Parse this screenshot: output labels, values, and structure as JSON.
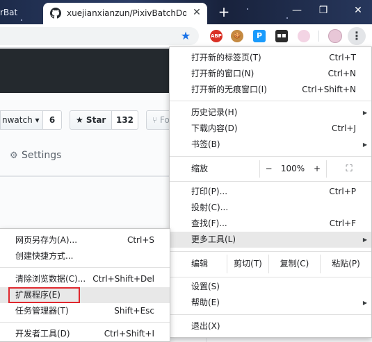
{
  "tabs": {
    "left_partial_title": "rBat",
    "active_title": "xuejianxianzun/PixivBatchDow",
    "close_glyph": "✕",
    "new_tab_glyph": "+"
  },
  "window_controls": {
    "minimize": "—",
    "restore": "❐",
    "close": "✕"
  },
  "toolbar": {
    "bookmark_icon": "star-icon",
    "extensions": [
      {
        "name": "adblock-plus",
        "label": "ABP"
      },
      {
        "name": "cookie",
        "label": "🍪"
      },
      {
        "name": "pixiv-p",
        "label": "P"
      },
      {
        "name": "dark-ext",
        "label": "▪▪"
      },
      {
        "name": "anime-ext",
        "label": ""
      }
    ],
    "menu_glyph": "⋮",
    "accent": "#1a73e8"
  },
  "github": {
    "watch_label": "nwatch ▾",
    "watch_count": "6",
    "star_label": "★ Star",
    "star_count": "132",
    "fork_partial": "⑂ Fo",
    "settings_tab": "Settings"
  },
  "menu": {
    "items": [
      {
        "label": "打开新的标签页(T)",
        "shortcut": "Ctrl+T"
      },
      {
        "label": "打开新的窗口(N)",
        "shortcut": "Ctrl+N"
      },
      {
        "label": "打开新的无痕窗口(I)",
        "shortcut": "Ctrl+Shift+N"
      },
      {
        "label": "历史记录(H)",
        "shortcut": ""
      },
      {
        "label": "下载内容(D)",
        "shortcut": "Ctrl+J"
      },
      {
        "label": "书签(B)",
        "shortcut": ""
      },
      {
        "label": "打印(P)...",
        "shortcut": "Ctrl+P"
      },
      {
        "label": "投射(C)...",
        "shortcut": ""
      },
      {
        "label": "查找(F)...",
        "shortcut": "Ctrl+F"
      },
      {
        "label": "更多工具(L)",
        "shortcut": ""
      },
      {
        "label": "设置(S)",
        "shortcut": ""
      },
      {
        "label": "帮助(E)",
        "shortcut": ""
      },
      {
        "label": "退出(X)",
        "shortcut": ""
      }
    ],
    "zoom": {
      "label": "缩放",
      "minus": "−",
      "value": "100%",
      "plus": "+",
      "fullscreen": "⛶"
    },
    "edit": {
      "label": "编辑",
      "cut": "剪切(T)",
      "copy": "复制(C)",
      "paste": "粘贴(P)"
    },
    "arrow": "▶"
  },
  "submenu": {
    "items": [
      {
        "label": "网页另存为(A)...",
        "shortcut": "Ctrl+S"
      },
      {
        "label": "创建快捷方式...",
        "shortcut": ""
      },
      {
        "label": "清除浏览数据(C)...",
        "shortcut": "Ctrl+Shift+Del"
      },
      {
        "label": "扩展程序(E)",
        "shortcut": ""
      },
      {
        "label": "任务管理器(T)",
        "shortcut": "Shift+Esc"
      },
      {
        "label": "开发者工具(D)",
        "shortcut": "Ctrl+Shift+I"
      }
    ],
    "highlight_color": "#e0282e"
  }
}
